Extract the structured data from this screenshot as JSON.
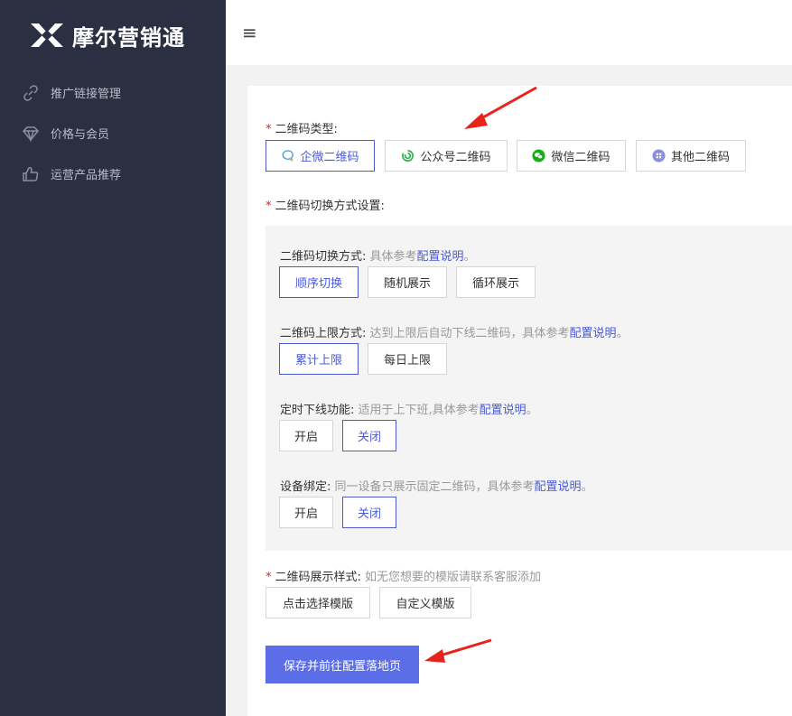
{
  "sidebar": {
    "logo_text": "摩尔营销通",
    "items": [
      {
        "label": "推广链接管理",
        "icon": "link-icon"
      },
      {
        "label": "价格与会员",
        "icon": "diamond-icon"
      },
      {
        "label": "运营产品推荐",
        "icon": "thumbs-up-icon"
      }
    ]
  },
  "topbar": {
    "menu_icon": "≡"
  },
  "qr_type": {
    "label": "二维码类型:",
    "required_mark": "*",
    "options": [
      {
        "label": "企微二维码",
        "icon": "wecom-icon",
        "selected": true
      },
      {
        "label": "公众号二维码",
        "icon": "official-account-icon",
        "selected": false
      },
      {
        "label": "微信二维码",
        "icon": "wechat-icon",
        "selected": false
      },
      {
        "label": "其他二维码",
        "icon": "other-qr-icon",
        "selected": false
      }
    ]
  },
  "switch_settings": {
    "label": "二维码切换方式设置:",
    "required_mark": "*",
    "switch_mode": {
      "label": "二维码切换方式:",
      "hint": "具体参考",
      "link": "配置说明",
      "end": "。",
      "options": [
        {
          "label": "顺序切换",
          "selected": true
        },
        {
          "label": "随机展示",
          "selected": false
        },
        {
          "label": "循环展示",
          "selected": false
        }
      ]
    },
    "limit_mode": {
      "label": "二维码上限方式:",
      "hint": "达到上限后自动下线二维码，具体参考",
      "link": "配置说明",
      "end": "。",
      "options": [
        {
          "label": "累计上限",
          "selected": true
        },
        {
          "label": "每日上限",
          "selected": false
        }
      ]
    },
    "timed_offline": {
      "label": "定时下线功能:",
      "hint": "适用于上下班,具体参考",
      "link": "配置说明",
      "end": "。",
      "options": [
        {
          "label": "开启",
          "selected": false
        },
        {
          "label": "关闭",
          "selected": true
        }
      ]
    },
    "device_bind": {
      "label": "设备绑定:",
      "hint": "同一设备只展示固定二维码，具体参考",
      "link": "配置说明",
      "end": "。",
      "options": [
        {
          "label": "开启",
          "selected": false
        },
        {
          "label": "关闭",
          "selected": true
        }
      ]
    }
  },
  "display_style": {
    "label": "二维码展示样式:",
    "required_mark": "*",
    "hint": "如无您想要的模版请联系客服添加",
    "options": [
      {
        "label": "点击选择模版"
      },
      {
        "label": "自定义模版"
      }
    ]
  },
  "submit_label": "保存并前往配置落地页",
  "colors": {
    "sidebar_bg": "#2a2f42",
    "accent": "#4a5ad6",
    "primary_button": "#5b6ee8",
    "annotation_arrow": "#e8231c"
  }
}
